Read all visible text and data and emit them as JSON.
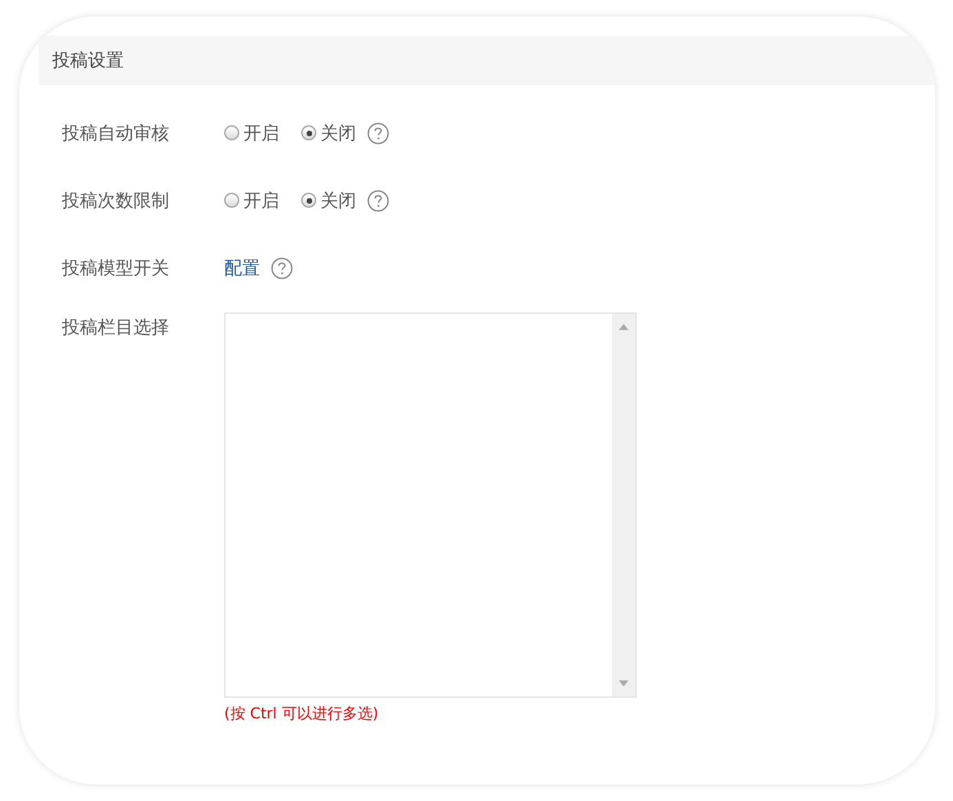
{
  "section": {
    "title": "投稿设置"
  },
  "rows": [
    {
      "kind": "radio",
      "label": "投稿自动审核",
      "options": [
        {
          "label": "开启",
          "selected": false
        },
        {
          "label": "关闭",
          "selected": true
        }
      ],
      "help": true
    },
    {
      "kind": "radio",
      "label": "投稿次数限制",
      "options": [
        {
          "label": "开启",
          "selected": false
        },
        {
          "label": "关闭",
          "selected": true
        }
      ],
      "help": true
    },
    {
      "kind": "link",
      "label": "投稿模型开关",
      "link": "配置",
      "help": true
    },
    {
      "kind": "listbox",
      "label": "投稿栏目选择",
      "hint": "(按 Ctrl 可以进行多选)"
    }
  ]
}
